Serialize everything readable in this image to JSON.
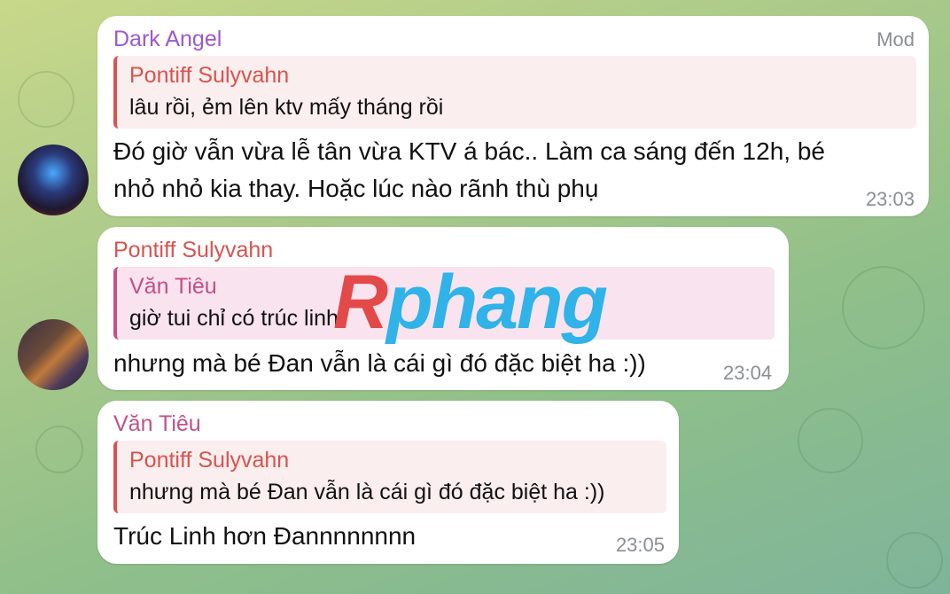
{
  "messages": [
    {
      "sender": "Dark Angel",
      "role": "Mod",
      "reply_to": {
        "name": "Pontiff Sulyvahn",
        "text": "lâu rồi, ẻm lên ktv mấy tháng rồi"
      },
      "text_lines": [
        "Đó giờ vẫn vừa lễ tân vừa KTV á bác.. Làm ca sáng đến 12h, bé",
        "nhỏ nhỏ kia thay. Hoặc lúc nào rãnh thù phụ"
      ],
      "time": "23:03"
    },
    {
      "sender": "Pontiff Sulyvahn",
      "reply_to": {
        "name": "Văn Tiêu",
        "text": "giờ tui chỉ có trúc linh"
      },
      "text_lines": [
        "nhưng mà bé Đan vẫn là cái gì đó đặc biệt ha :))"
      ],
      "time": "23:04"
    },
    {
      "sender": "Văn Tiêu",
      "reply_to": {
        "name": "Pontiff Sulyvahn",
        "text": "nhưng mà bé Đan vẫn là cái gì đó đặc biệt ha :))"
      },
      "text_lines": [
        "Trúc Linh hơn Đannnnnnnn"
      ],
      "time": "23:05"
    }
  ],
  "watermark": {
    "part1": "R",
    "part2": "phang"
  },
  "colors": {
    "dark_angel": "#9b59d0",
    "pontiff": "#d9534f",
    "van_tieu": "#c2508a",
    "quote_red_bg": "#fbeeee",
    "quote_pink_bg": "#f8e3ee"
  }
}
